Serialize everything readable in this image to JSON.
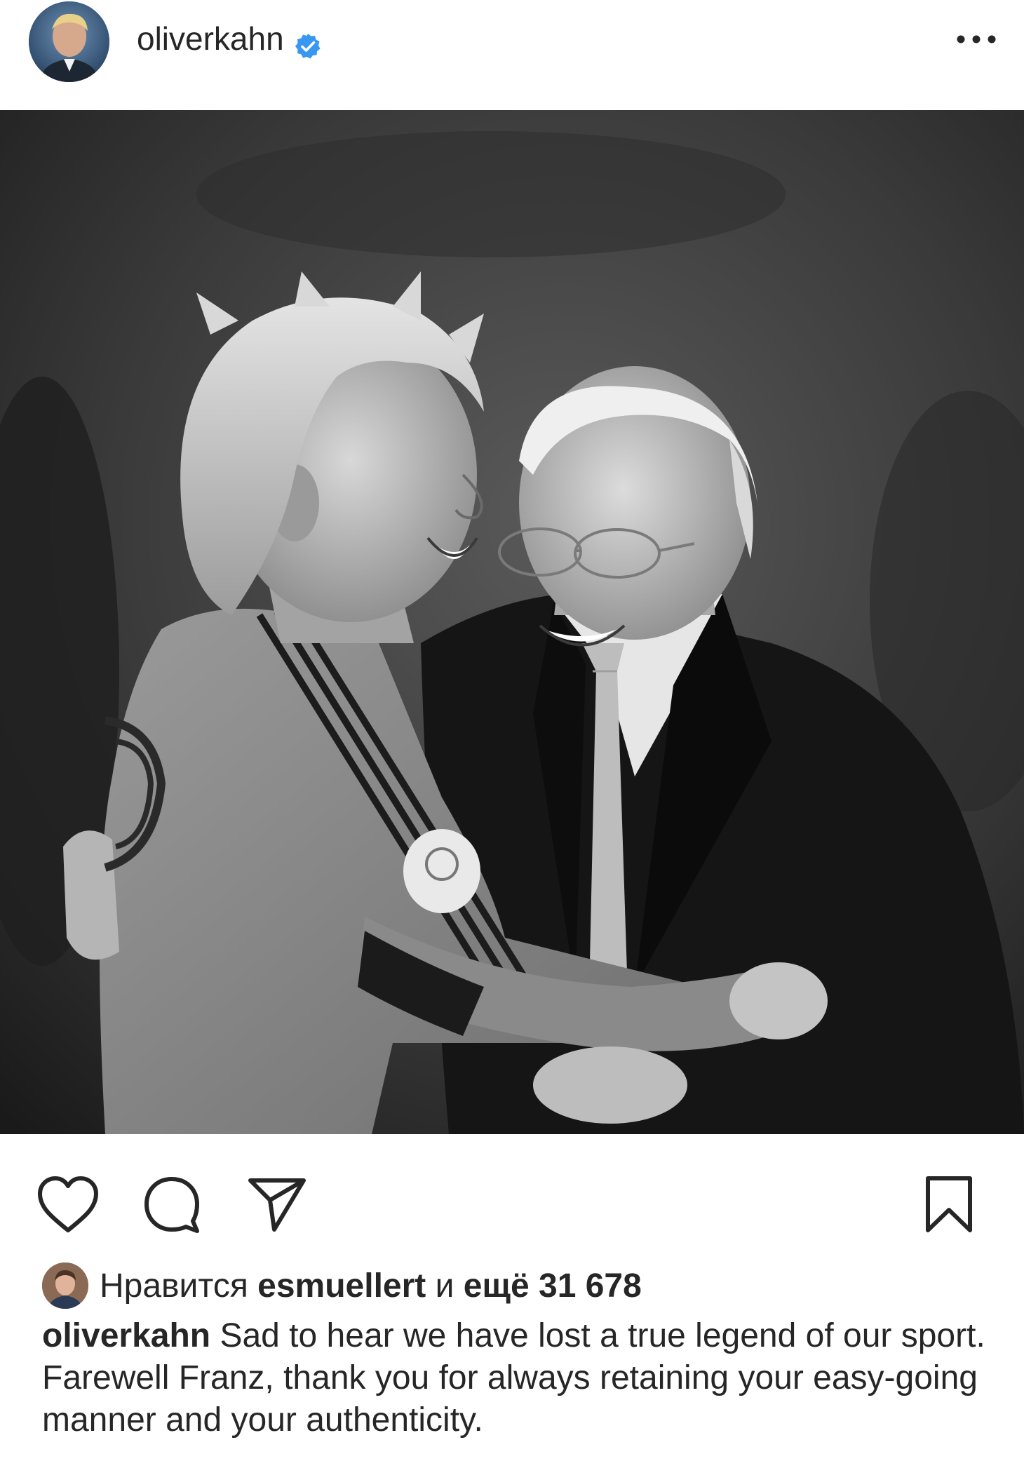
{
  "header": {
    "username": "oliverkahn",
    "verified": true,
    "more_icon": "more-horizontal-icon"
  },
  "post": {
    "image_icon": "photo-two-men-embracing-black-and-white"
  },
  "actions": {
    "like_icon": "heart-icon",
    "comment_icon": "comment-icon",
    "share_icon": "send-icon",
    "save_icon": "bookmark-icon"
  },
  "likes": {
    "prefix": "Нравится",
    "user": "esmuellert",
    "conjunction": "и",
    "others": "ещё 31 678"
  },
  "caption": {
    "username": "oliverkahn",
    "text": "Sad to hear we have lost a true legend of our sport. Farewell Franz, thank you for always retaining your easy-going manner and your authenticity."
  },
  "colors": {
    "text": "#262626",
    "verified_blue": "#3897f0",
    "background": "#ffffff"
  }
}
